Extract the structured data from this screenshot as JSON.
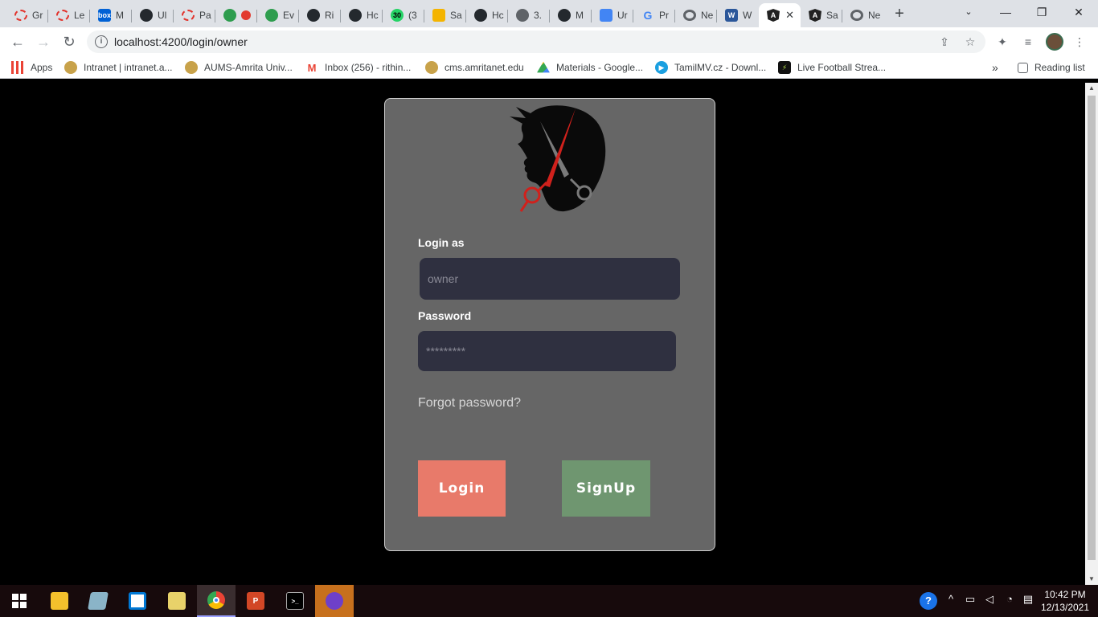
{
  "browser": {
    "tabs": [
      {
        "label": "Gr",
        "icon": "opera-icon"
      },
      {
        "label": "Le",
        "icon": "opera-icon"
      },
      {
        "label": "M",
        "icon": "box-icon"
      },
      {
        "label": "Ul",
        "icon": "github-icon"
      },
      {
        "label": "Pa",
        "icon": "opera-icon"
      },
      {
        "label": "",
        "icon": "record-icon"
      },
      {
        "label": "Ev",
        "icon": "recycle-icon"
      },
      {
        "label": "Ri",
        "icon": "github-icon"
      },
      {
        "label": "Hc",
        "icon": "github-icon"
      },
      {
        "label": "(3",
        "icon": "whatsapp-icon"
      },
      {
        "label": "Sa",
        "icon": "slides-icon"
      },
      {
        "label": "Hc",
        "icon": "github-icon"
      },
      {
        "label": "3.",
        "icon": "globe-icon"
      },
      {
        "label": "M",
        "icon": "github-icon"
      },
      {
        "label": "Ur",
        "icon": "docs-icon"
      },
      {
        "label": "Pr",
        "icon": "google-icon"
      },
      {
        "label": "Ne",
        "icon": "chrome-icon"
      },
      {
        "label": "W",
        "icon": "word-icon"
      },
      {
        "label": "",
        "icon": "angular-icon",
        "active": true
      },
      {
        "label": "Sa",
        "icon": "angular-icon"
      },
      {
        "label": "Ne",
        "icon": "chrome-icon"
      }
    ],
    "new_tab": "+",
    "url": "localhost:4200/login/owner",
    "reading_list": "Reading list",
    "apps_label": "Apps",
    "bookmarks": [
      {
        "label": "Intranet | intranet.a...",
        "color": "#c8a24a"
      },
      {
        "label": "AUMS-Amrita Univ...",
        "color": "#c8a24a"
      },
      {
        "label": "Inbox (256) - rithin...",
        "color": "#ea4335"
      },
      {
        "label": "cms.amritanet.edu",
        "color": "#c8a24a"
      },
      {
        "label": "Materials - Google...",
        "color": "#1fa463"
      },
      {
        "label": "TamilMV.cz - Downl...",
        "color": "#1a9fe0"
      },
      {
        "label": "Live Football Strea...",
        "color": "#111111"
      }
    ]
  },
  "login": {
    "login_as_label": "Login as",
    "login_as_placeholder": "owner",
    "password_label": "Password",
    "password_placeholder": "*********",
    "forgot_label": "Forgot password?",
    "login_button": "Login",
    "signup_button": "SignUp"
  },
  "colors": {
    "card_bg": "#666666",
    "field_bg": "#2f3040",
    "login_btn": "#e87a6a",
    "signup_btn": "#6f9670",
    "logo_accent": "#d0211c"
  },
  "taskbar": {
    "apps": [
      "windows-start-icon",
      "file-explorer-icon",
      "notebook-icon",
      "store-icon",
      "folder-icon",
      "chrome-icon",
      "powerpoint-icon",
      "terminal-icon",
      "github-desktop-icon"
    ],
    "time": "10:42 PM",
    "date": "12/13/2021"
  }
}
